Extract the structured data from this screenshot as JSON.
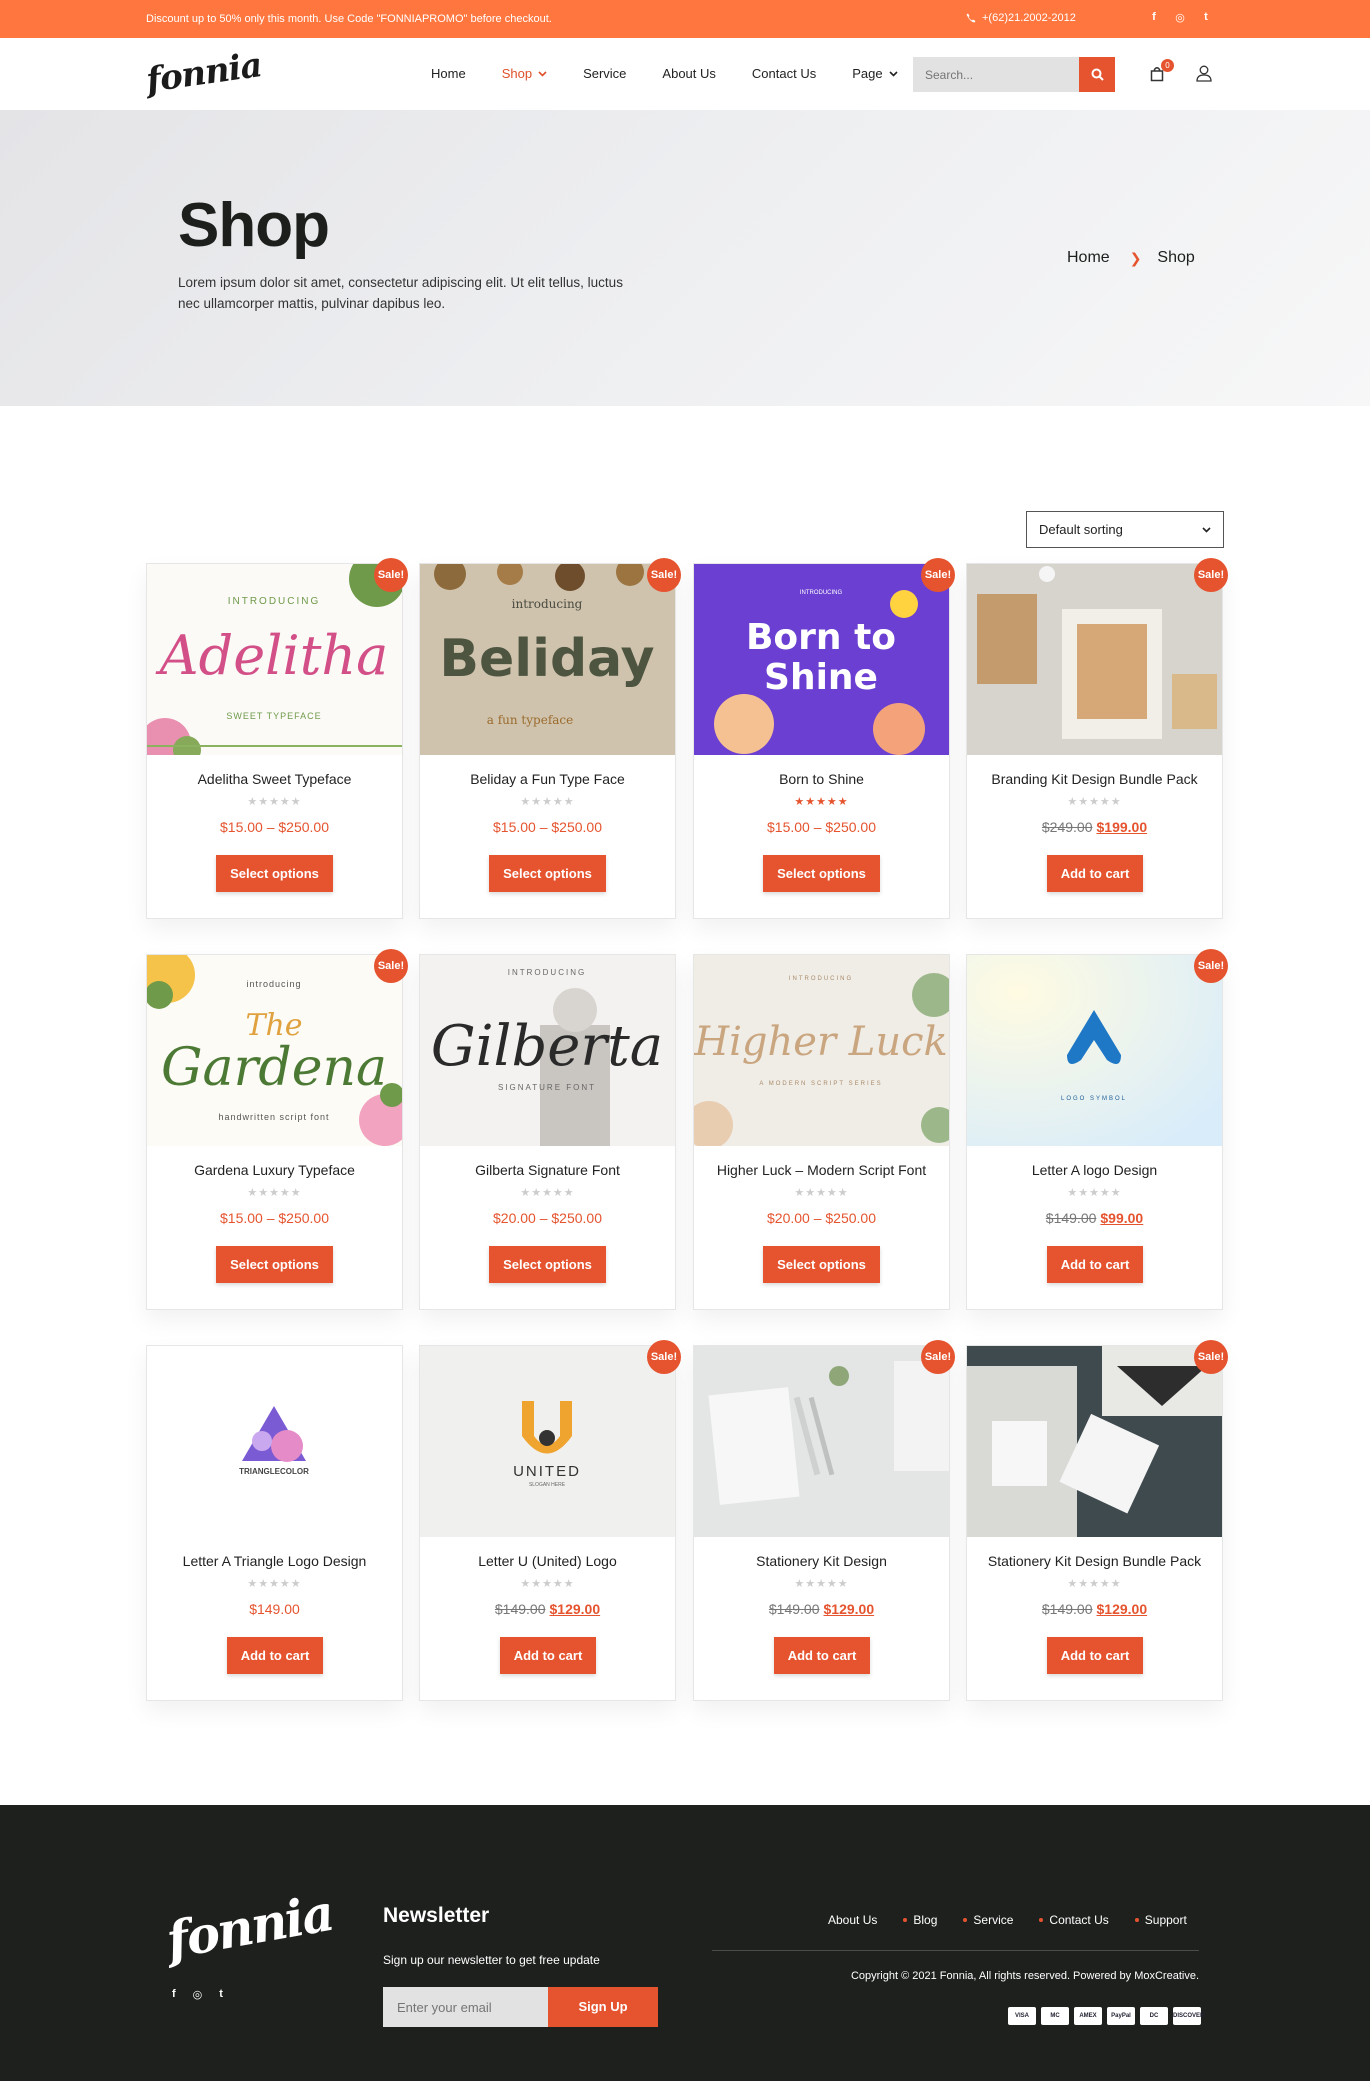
{
  "topbar": {
    "promo": "Discount up to 50% only this month. Use Code \"FONNIAPROMO\" before checkout.",
    "phone": "+(62)21.2002-2012",
    "socials": [
      "f",
      "◎",
      "t"
    ]
  },
  "header": {
    "logo": "fonnia",
    "nav": [
      {
        "label": "Home"
      },
      {
        "label": "Shop"
      },
      {
        "label": "Service"
      },
      {
        "label": "About Us"
      },
      {
        "label": "Contact Us"
      },
      {
        "label": "Page"
      }
    ],
    "search_placeholder": "Search...",
    "cart_count": "0",
    "accent": "#e5542f"
  },
  "hero": {
    "title": "Shop",
    "description": "Lorem ipsum dolor sit amet, consectetur adipiscing elit. Ut elit tellus, luctus nec ullamcorper mattis, pulvinar dapibus leo.",
    "breadcrumb": [
      "Home",
      "Shop"
    ]
  },
  "sorting": {
    "selected": "Default sorting"
  },
  "products": [
    {
      "title": "Adelitha Sweet Typeface",
      "sale": "Sale!",
      "price": "$15.00 – $250.00",
      "old_price": "",
      "new_price": "",
      "button": "Select options",
      "rating": 0,
      "image": "Adelitha",
      "image_sub": "INTRODUCING",
      "image_sub2": "SWEET TYPEFACE"
    },
    {
      "title": "Beliday a Fun Type Face",
      "sale": "Sale!",
      "price": "$15.00 – $250.00",
      "old_price": "",
      "new_price": "",
      "button": "Select options",
      "rating": 0,
      "image": "Beliday",
      "image_sub": "introducing",
      "image_sub2": "a fun typeface"
    },
    {
      "title": "Born to Shine",
      "sale": "Sale!",
      "price": "$15.00 – $250.00",
      "old_price": "",
      "new_price": "",
      "button": "Select options",
      "rating": 5,
      "image": "Born to Shine",
      "image_sub": "INTRODUCING",
      "image_sub2": ""
    },
    {
      "title": "Branding Kit Design Bundle Pack",
      "sale": "Sale!",
      "price": "",
      "old_price": "$249.00",
      "new_price": "$199.00",
      "button": "Add to cart",
      "rating": 0,
      "image": "",
      "image_sub": "",
      "image_sub2": ""
    },
    {
      "title": "Gardena Luxury Typeface",
      "sale": "Sale!",
      "price": "$15.00 – $250.00",
      "old_price": "",
      "new_price": "",
      "button": "Select options",
      "rating": 0,
      "image": "The Gardena",
      "image_sub": "introducing",
      "image_sub2": "handwritten script font"
    },
    {
      "title": "Gilberta Signature Font",
      "sale": "",
      "price": "$20.00 – $250.00",
      "old_price": "",
      "new_price": "",
      "button": "Select options",
      "rating": 0,
      "image": "Gilberta",
      "image_sub": "INTRODUCING",
      "image_sub2": "SIGNATURE FONT"
    },
    {
      "title": "Higher Luck – Modern Script Font",
      "sale": "",
      "price": "$20.00 – $250.00",
      "old_price": "",
      "new_price": "",
      "button": "Select options",
      "rating": 0,
      "image": "Higher Luck",
      "image_sub": "INTRODUCING",
      "image_sub2": "A MODERN SCRIPT SERIES"
    },
    {
      "title": "Letter A logo Design",
      "sale": "Sale!",
      "price": "",
      "old_price": "$149.00",
      "new_price": "$99.00",
      "button": "Add to cart",
      "rating": 0,
      "image": "",
      "image_sub": "LOGO SYMBOL",
      "image_sub2": ""
    },
    {
      "title": "Letter A Triangle Logo Design",
      "sale": "",
      "price": "$149.00",
      "old_price": "",
      "new_price": "",
      "button": "Add to cart",
      "rating": 0,
      "image": "",
      "image_sub": "TRIANGLECOLOR",
      "image_sub2": ""
    },
    {
      "title": "Letter U (United) Logo",
      "sale": "Sale!",
      "price": "",
      "old_price": "$149.00",
      "new_price": "$129.00",
      "button": "Add to cart",
      "rating": 0,
      "image": "UNITED",
      "image_sub": "SLOGAN HERE",
      "image_sub2": ""
    },
    {
      "title": "Stationery Kit Design",
      "sale": "Sale!",
      "price": "",
      "old_price": "$149.00",
      "new_price": "$129.00",
      "button": "Add to cart",
      "rating": 0,
      "image": "",
      "image_sub": "",
      "image_sub2": ""
    },
    {
      "title": "Stationery Kit Design Bundle Pack",
      "sale": "Sale!",
      "price": "",
      "old_price": "$149.00",
      "new_price": "$129.00",
      "button": "Add to cart",
      "rating": 0,
      "image": "",
      "image_sub": "",
      "image_sub2": ""
    }
  ],
  "footer": {
    "logo": "fonnia",
    "newsletter_title": "Newsletter",
    "newsletter_sub": "Sign up our newsletter to get free update",
    "email_placeholder": "Enter your email",
    "signup": "Sign Up",
    "links": [
      "About Us",
      "Blog",
      "Service",
      "Contact Us",
      "Support"
    ],
    "copyright": "Copyright © 2021 Fonnia, All rights reserved. Powered by MoxCreative.",
    "payments": [
      "VISA",
      "MC",
      "AMEX",
      "PayPal",
      "DC",
      "DISCOVER"
    ],
    "socials": [
      "f",
      "◎",
      "t"
    ]
  }
}
